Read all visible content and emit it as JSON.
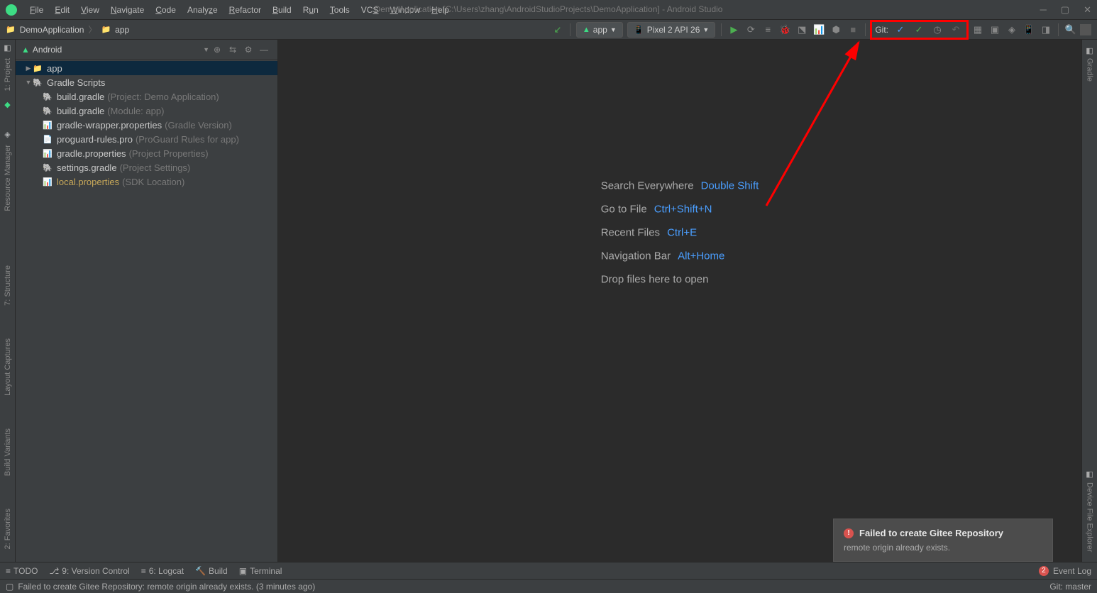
{
  "menubar": [
    "File",
    "Edit",
    "View",
    "Navigate",
    "Code",
    "Analyze",
    "Refactor",
    "Build",
    "Run",
    "Tools",
    "VCS",
    "Window",
    "Help"
  ],
  "window_title": "Demo Application [C:\\Users\\zhang\\AndroidStudioProjects\\DemoApplication] - Android Studio",
  "breadcrumb": {
    "project": "DemoApplication",
    "module": "app"
  },
  "run_config": {
    "module": "app",
    "device": "Pixel 2 API 26"
  },
  "git_label": "Git:",
  "panel": {
    "title": "Android"
  },
  "tree": {
    "app": "app",
    "gradle_scripts": "Gradle Scripts",
    "files": [
      {
        "name": "build.gradle",
        "hint": "(Project: Demo Application)",
        "icon": "gradle"
      },
      {
        "name": "build.gradle",
        "hint": "(Module: app)",
        "icon": "gradle"
      },
      {
        "name": "gradle-wrapper.properties",
        "hint": "(Gradle Version)",
        "icon": "prop"
      },
      {
        "name": "proguard-rules.pro",
        "hint": "(ProGuard Rules for app)",
        "icon": "txt"
      },
      {
        "name": "gradle.properties",
        "hint": "(Project Properties)",
        "icon": "prop"
      },
      {
        "name": "settings.gradle",
        "hint": "(Project Settings)",
        "icon": "gradle"
      },
      {
        "name": "local.properties",
        "hint": "(SDK Location)",
        "icon": "prop",
        "yellow": true
      }
    ]
  },
  "left_gutter": [
    "1: Project",
    "Resource Manager",
    "7: Structure",
    "Layout Captures",
    "Build Variants",
    "2: Favorites"
  ],
  "right_gutter": [
    "Gradle",
    "Device File Explorer"
  ],
  "shortcuts": [
    {
      "label": "Search Everywhere",
      "key": "Double Shift"
    },
    {
      "label": "Go to File",
      "key": "Ctrl+Shift+N"
    },
    {
      "label": "Recent Files",
      "key": "Ctrl+E"
    },
    {
      "label": "Navigation Bar",
      "key": "Alt+Home"
    },
    {
      "label": "Drop files here to open",
      "key": ""
    }
  ],
  "notification": {
    "title": "Failed to create Gitee Repository",
    "body": "remote origin already exists."
  },
  "bottom_tabs": {
    "todo": "TODO",
    "vcs": "9: Version Control",
    "logcat": "6: Logcat",
    "build": "Build",
    "terminal": "Terminal",
    "eventlog": "Event Log",
    "badge": "2"
  },
  "statusbar": {
    "msg": "Failed to create Gitee Repository: remote origin already exists. (3 minutes ago)",
    "branch": "Git: master"
  }
}
